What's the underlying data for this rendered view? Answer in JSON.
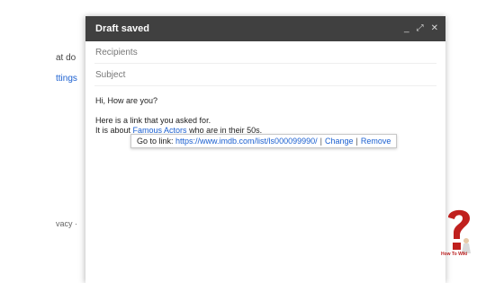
{
  "background": {
    "fragment_what": "at do",
    "fragment_settings": "ttings",
    "fragment_privacy": "vacy ·"
  },
  "compose": {
    "title": "Draft saved",
    "controls": {
      "minimize": "_",
      "expand": "⤢",
      "close": "✕"
    },
    "recipients_placeholder": "Recipients",
    "subject_placeholder": "Subject",
    "body": {
      "greeting": "Hi, How are you?",
      "line1": "Here is a link that you asked for.",
      "line2_prefix": "It is about ",
      "link_text": "Famous Actors",
      "line2_suffix": " who are in their 50s."
    },
    "link_tooltip": {
      "prefix": "Go to link: ",
      "url": "https://www.imdb.com/list/ls000099990/",
      "separator": "|",
      "change": "Change",
      "remove": "Remove"
    }
  },
  "watermark": {
    "text": "How To Wiki"
  },
  "colors": {
    "titlebar": "#404040",
    "link": "#1a5fd0",
    "logo_red": "#c0201e"
  }
}
